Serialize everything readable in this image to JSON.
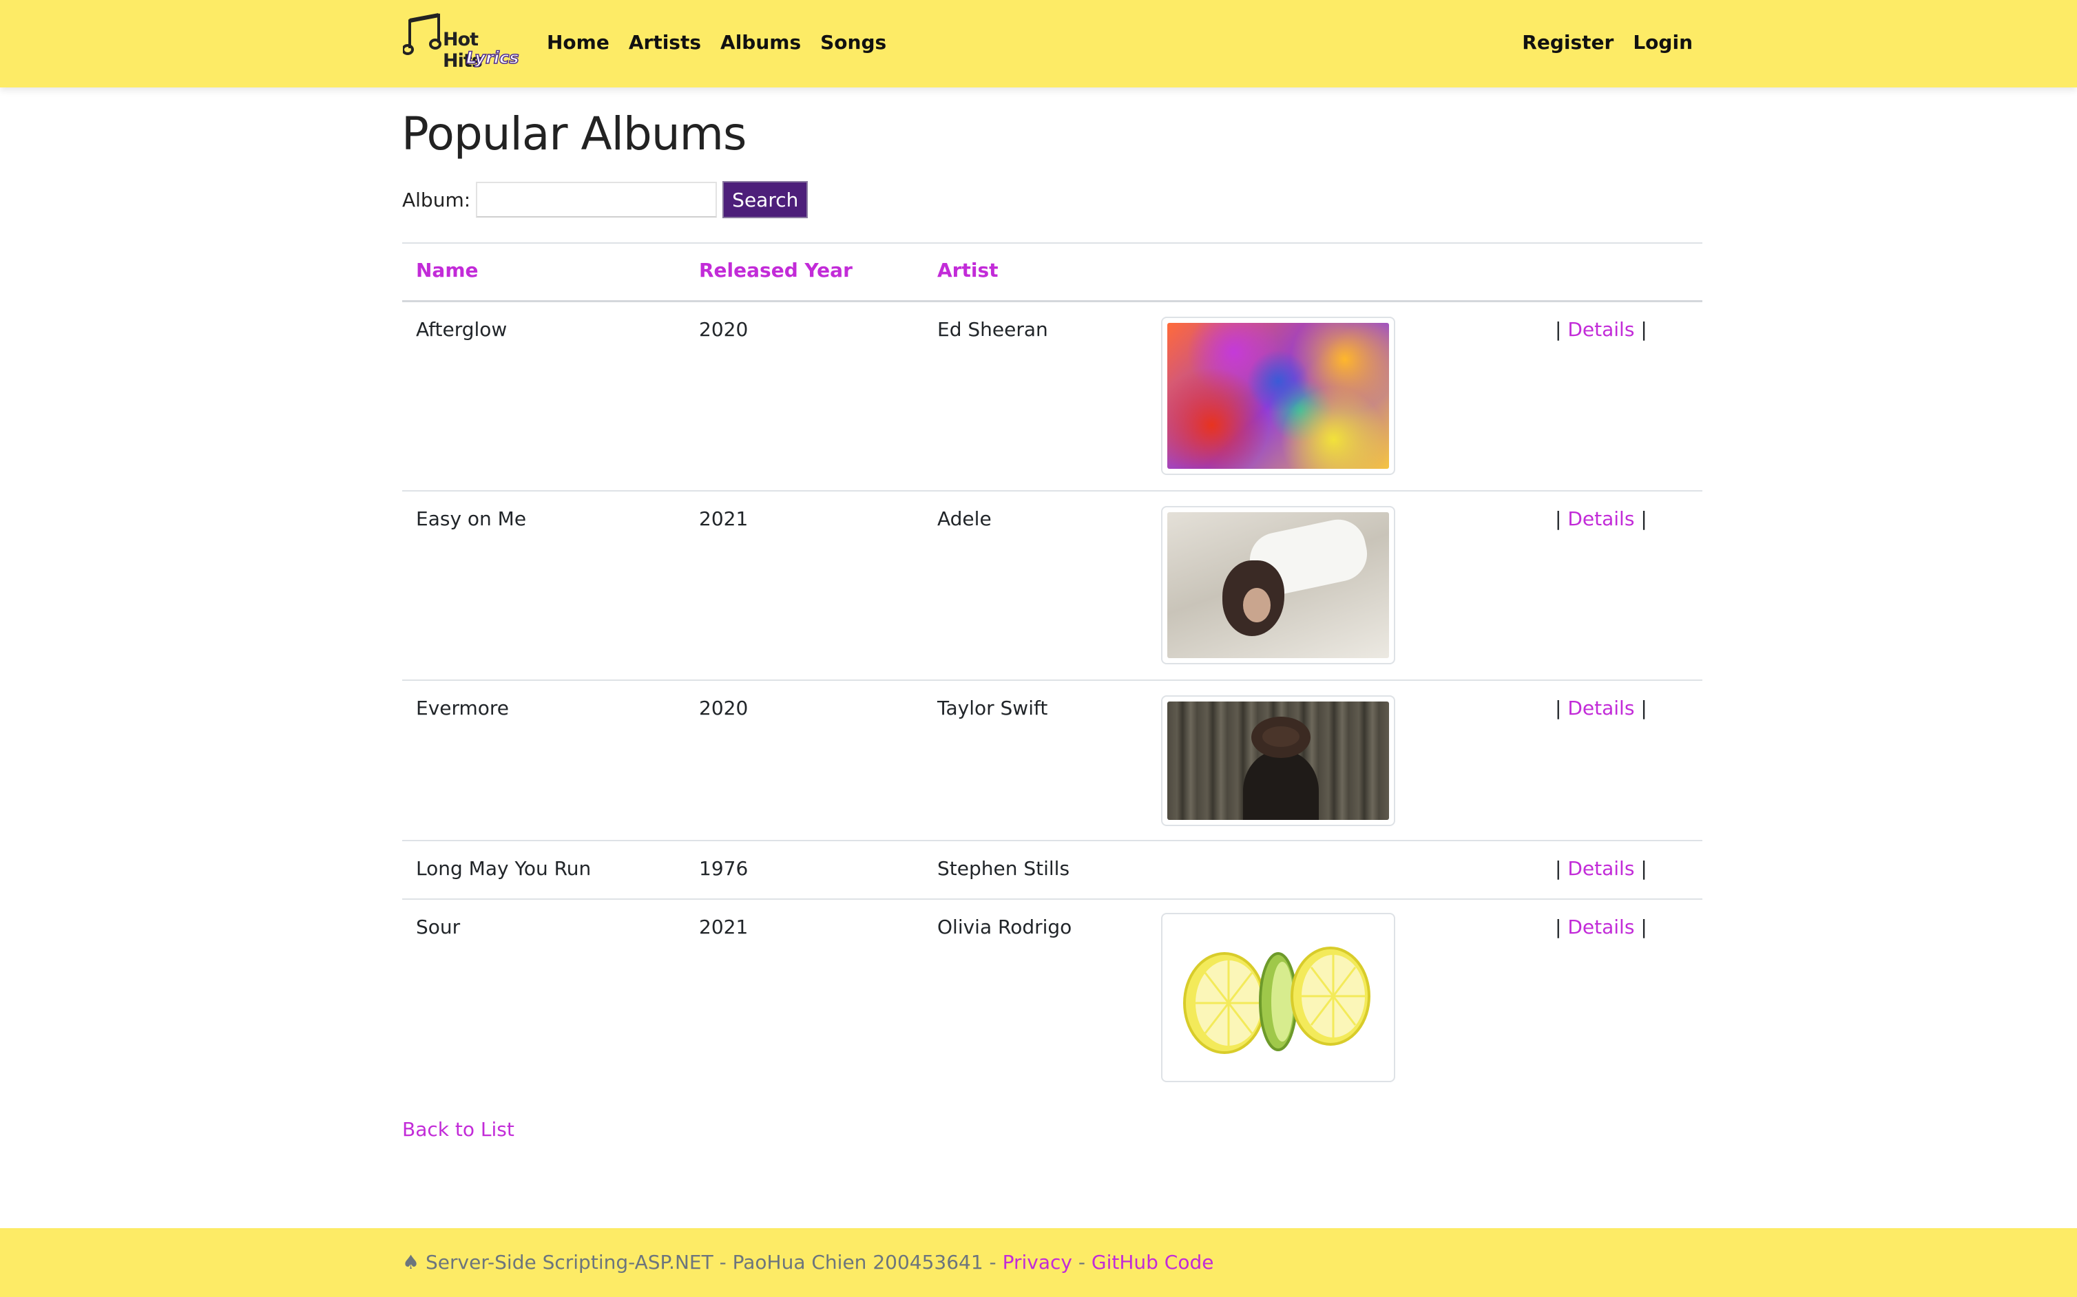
{
  "brand": {
    "line1": "Hot Hits",
    "line2": "Lyrics",
    "note_icon": "music-note-icon",
    "accent": "#4d2b8c"
  },
  "nav": {
    "left": [
      "Home",
      "Artists",
      "Albums",
      "Songs"
    ],
    "right": [
      "Register",
      "Login"
    ]
  },
  "page": {
    "title": "Popular Albums"
  },
  "search": {
    "label": "Album:",
    "value": "",
    "placeholder": "",
    "button": "Search"
  },
  "table": {
    "headers": {
      "name": "Name",
      "year": "Released Year",
      "artist": "Artist"
    },
    "rows": [
      {
        "name": "Afterglow",
        "year": "2020",
        "artist": "Ed Sheeran",
        "image": "abstract-colorful-painting",
        "details": "Details"
      },
      {
        "name": "Easy on Me",
        "year": "2021",
        "artist": "Adele",
        "image": "woman-lying-on-fur",
        "details": "Details"
      },
      {
        "name": "Evermore",
        "year": "2020",
        "artist": "Taylor Swift",
        "image": "woman-with-hat-in-forest",
        "details": "Details"
      },
      {
        "name": "Long May You Run",
        "year": "1976",
        "artist": "Stephen Stills",
        "image": "",
        "details": "Details"
      },
      {
        "name": "Sour",
        "year": "2021",
        "artist": "Olivia Rodrigo",
        "image": "lemon-and-lime-slices",
        "details": "Details"
      }
    ],
    "separator": "|"
  },
  "back_link": "Back to List",
  "footer": {
    "symbol": "♠",
    "text": "Server-Side Scripting-ASP.NET - PaoHua Chien 200453641 -",
    "dash": "-",
    "privacy": "Privacy",
    "github": "GitHub Code"
  },
  "colors": {
    "navbar": "#fdeb66",
    "link": "#c22bd8",
    "button": "#4d1f7a"
  }
}
